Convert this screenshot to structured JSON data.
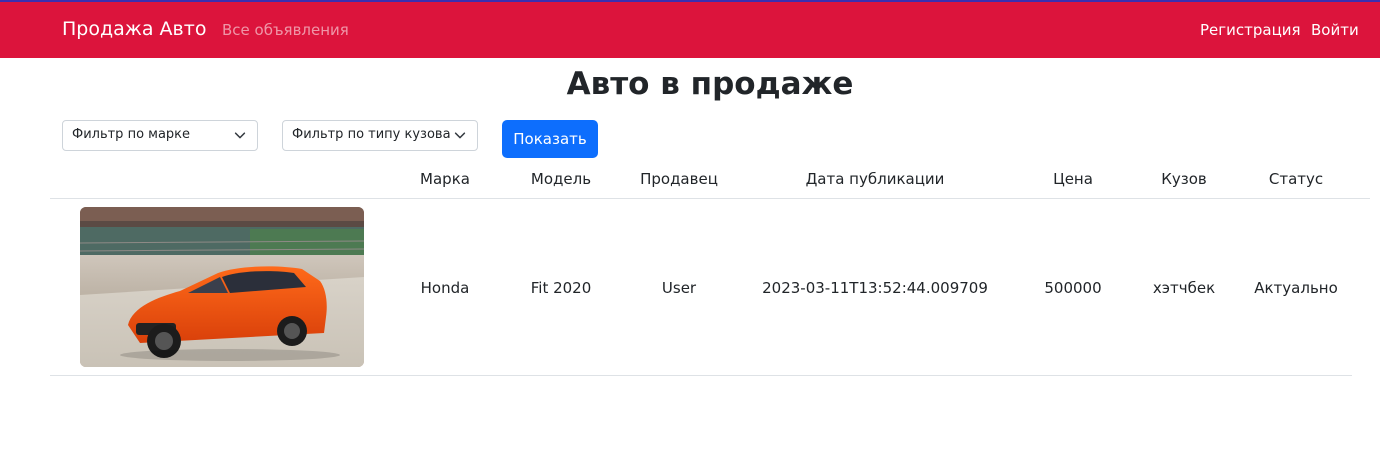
{
  "navbar": {
    "brand": "Продажа Авто",
    "all_listings": "Все объявления",
    "register": "Регистрация",
    "login": "Войти",
    "bg_color": "#dc143c"
  },
  "page": {
    "title": "Авто в продаже"
  },
  "filters": {
    "brand_filter": "Фильтр по марке",
    "body_filter": "Фильтр по типу кузова",
    "show_button": "Показать"
  },
  "table": {
    "headers": [
      "Марка",
      "Модель",
      "Продавец",
      "Дата публикации",
      "Цена",
      "Кузов",
      "Статус"
    ],
    "rows": [
      {
        "image": "orange-hatchback-photo",
        "brand": "Honda",
        "model": "Fit 2020",
        "seller": "User",
        "date": "2023-03-11T13:52:44.009709",
        "price": "500000",
        "body": "хэтчбек",
        "status": "Актуально"
      }
    ]
  }
}
